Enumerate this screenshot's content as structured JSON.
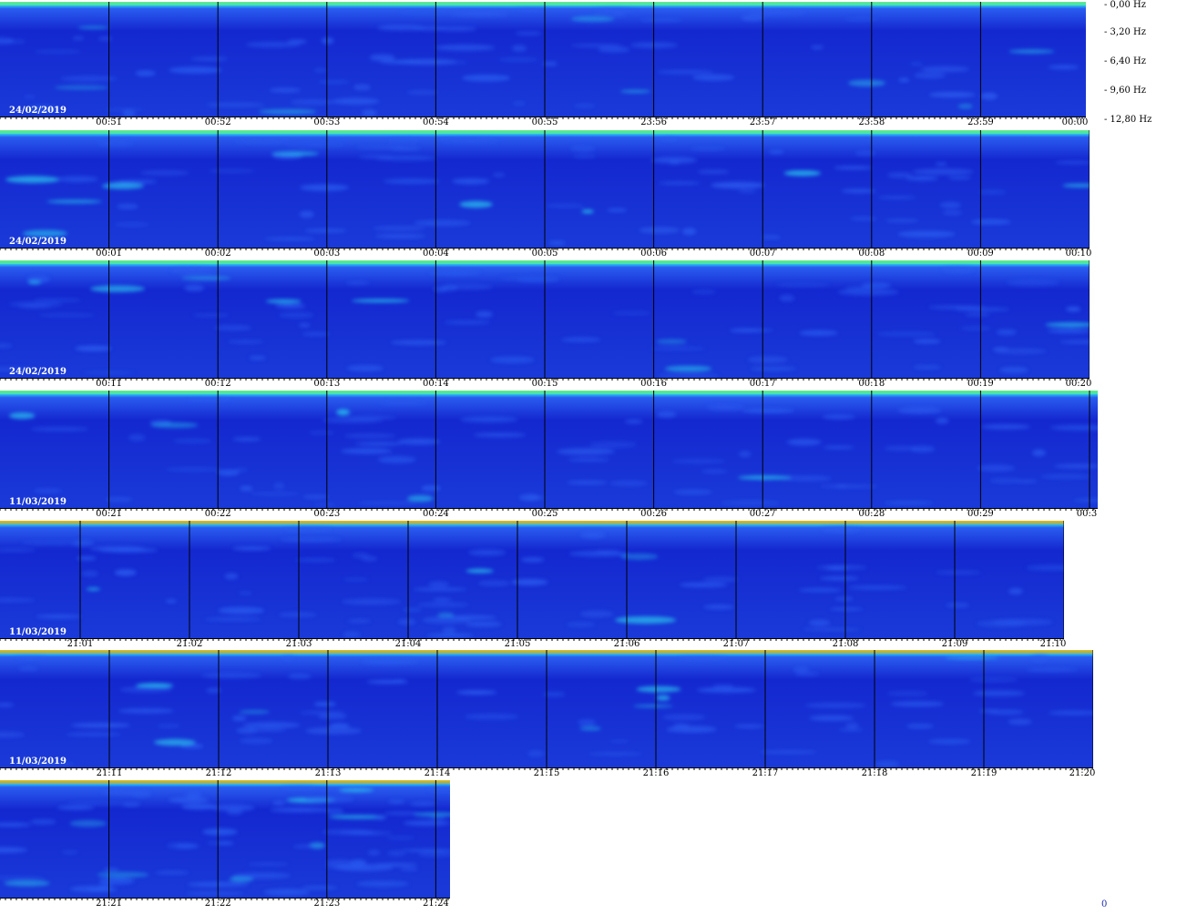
{
  "chart_data": {
    "type": "heatmap",
    "title": "",
    "frequency_axis": {
      "labels": [
        "0,00 Hz",
        "3,20 Hz",
        "6,40 Hz",
        "9,60 Hz",
        "12,80 Hz"
      ],
      "range_hz": [
        0,
        12.8
      ]
    },
    "colorscale": [
      "#1428d0",
      "#2a5cf0",
      "#28c8f0",
      "#4de6a0",
      "#f0f020",
      "#f09010",
      "#c81010"
    ],
    "rows": [
      {
        "date": "24/02/2019",
        "ticks": [
          "00:51",
          "00:52",
          "00:53",
          "00:54",
          "00:55",
          "23:56",
          "23:57",
          "23:58",
          "23:59",
          "00:00"
        ]
      },
      {
        "date": "24/02/2019",
        "ticks": [
          "00:01",
          "00:02",
          "00:03",
          "00:04",
          "00:05",
          "00:06",
          "00:07",
          "00:08",
          "00:09",
          "00:10"
        ]
      },
      {
        "date": "24/02/2019",
        "ticks": [
          "00:11",
          "00:12",
          "00:13",
          "00:14",
          "00:15",
          "00:16",
          "00:17",
          "00:18",
          "00:19",
          "00:20"
        ]
      },
      {
        "date": "11/03/2019",
        "ticks": [
          "00:21",
          "00:22",
          "00:23",
          "00:24",
          "00:25",
          "00:26",
          "00:27",
          "00:28",
          "00:29",
          "00:3"
        ]
      },
      {
        "date": "11/03/2019",
        "ticks": [
          "21:01",
          "21:02",
          "21:03",
          "21:04",
          "21:05",
          "21:06",
          "21:07",
          "21:08",
          "21:09",
          "21:10"
        ]
      },
      {
        "date": "11/03/2019",
        "ticks": [
          "21:11",
          "21:12",
          "21:13",
          "21:14",
          "21:15",
          "21:16",
          "21:17",
          "21:18",
          "21:19",
          "21:20"
        ]
      },
      {
        "date": "",
        "ticks": [
          "21:21",
          "21:22",
          "21:23",
          "21:24"
        ]
      }
    ]
  },
  "corner_label": "0"
}
